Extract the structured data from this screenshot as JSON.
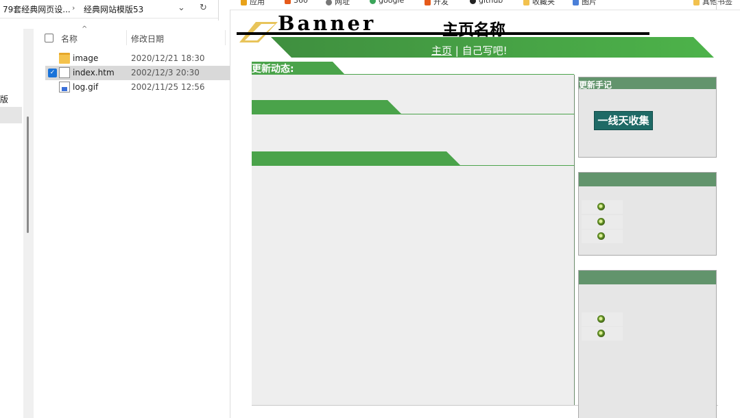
{
  "explorer": {
    "breadcrumb": [
      "79套经典网页设...",
      "经典网站模版53"
    ],
    "nav_partial_text": "版",
    "columns": {
      "name": "名称",
      "date": "修改日期"
    },
    "files": [
      {
        "name": "image",
        "date": "2020/12/21 18:30",
        "type": "folder",
        "selected": false
      },
      {
        "name": "index.htm",
        "date": "2002/12/3 20:30",
        "type": "file",
        "selected": true
      },
      {
        "name": "log.gif",
        "date": "2002/11/25 12:56",
        "type": "gif",
        "selected": false
      }
    ]
  },
  "browser": {
    "bookmarks": [
      "应用",
      "360",
      "网址",
      "google",
      "开发",
      "github",
      "收藏夹",
      "图片",
      "其他书签"
    ]
  },
  "page": {
    "banner_text": "Banner",
    "site_title": "主页名称",
    "nav_home": "主页",
    "nav_sep": " | ",
    "nav_custom": "自己写吧!",
    "update_label": "更新动态:",
    "sidebar_box1_title": "更新手记",
    "collect_button": "一线天收集",
    "sidebar_box2_title": "",
    "sidebar_box3_title": ""
  },
  "colors": {
    "green_accent": "#4aa34a",
    "sidebar_header": "#62946c",
    "collect_button_bg": "#1f6a66",
    "panel_bg": "#eeeeee",
    "selection": "#d9d9d9"
  }
}
